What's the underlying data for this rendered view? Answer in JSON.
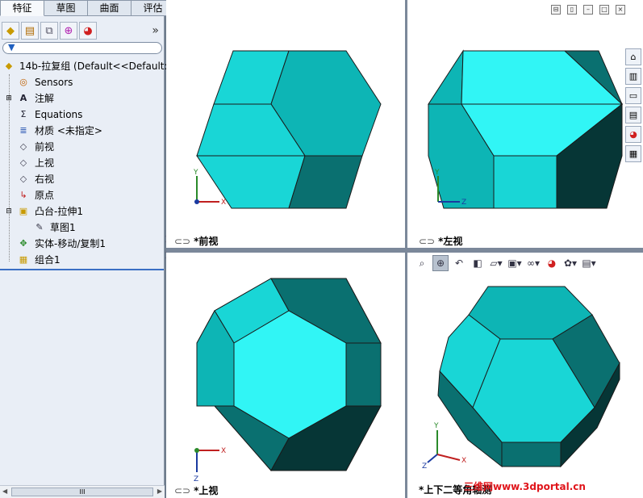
{
  "tabs": [
    "特征",
    "草图",
    "曲面",
    "评估"
  ],
  "active_tab": "特征",
  "panel_toolbar": {
    "icons": [
      "feature-manager-icon",
      "property-manager-icon",
      "configuration-manager-icon",
      "dimxpert-icon",
      "display-manager-icon"
    ],
    "more_label": "»"
  },
  "filter_icon": "funnel-icon",
  "tree": {
    "root": "14b-拉复组  (Default<<Default:",
    "items": [
      {
        "label": "Sensors",
        "icon": "sensors-icon"
      },
      {
        "label": "注解",
        "icon": "annotations-icon"
      },
      {
        "label": "Equations",
        "icon": "equations-icon"
      },
      {
        "label": "材质 <未指定>",
        "icon": "material-icon"
      },
      {
        "label": "前视",
        "icon": "plane-icon"
      },
      {
        "label": "上视",
        "icon": "plane-icon"
      },
      {
        "label": "右视",
        "icon": "plane-icon"
      },
      {
        "label": "原点",
        "icon": "origin-icon"
      },
      {
        "label": "凸台-拉伸1",
        "icon": "extrude-icon"
      },
      {
        "label": "草图1",
        "icon": "sketch-icon"
      },
      {
        "label": "实体-移动/复制1",
        "icon": "move-copy-icon"
      },
      {
        "label": "组合1",
        "icon": "combine-icon"
      }
    ]
  },
  "scrollbar_label": "III",
  "viewports": [
    {
      "label": "*前视",
      "axes": [
        "Y",
        "X"
      ]
    },
    {
      "label": "*左视",
      "axes": [
        "Y",
        "Z"
      ]
    },
    {
      "label": "*上视",
      "axes": [
        "Z",
        "X"
      ]
    },
    {
      "label": "*上下二等角轴测",
      "axes": [
        "Y",
        "X",
        "Z"
      ]
    }
  ],
  "viewport_controls": [
    "restore-icon",
    "tile-icon",
    "minimize-icon",
    "maximize-icon",
    "close-icon"
  ],
  "colors": {
    "face_light": "#31f5f5",
    "face_mid": "#19d6d6",
    "face_teal": "#0db5b5",
    "face_dark": "#0a7070",
    "face_darker": "#063636",
    "edge": "#1a1a1a",
    "selection_line": "#3a6fc4"
  },
  "taskpane": [
    "home-icon",
    "design-library-icon",
    "file-explorer-icon",
    "view-palette-icon",
    "appearances-icon",
    "custom-properties-icon"
  ],
  "heads_up_toolbar": [
    "zoom-to-fit-icon",
    "zoom-area-icon",
    "previous-view-icon",
    "section-view-icon",
    "view-orientation-icon",
    "display-style-icon",
    "hide-show-icon",
    "edit-appearance-icon",
    "apply-scene-icon",
    "view-settings-icon"
  ],
  "watermark": "三维网www.3dportal.cn"
}
